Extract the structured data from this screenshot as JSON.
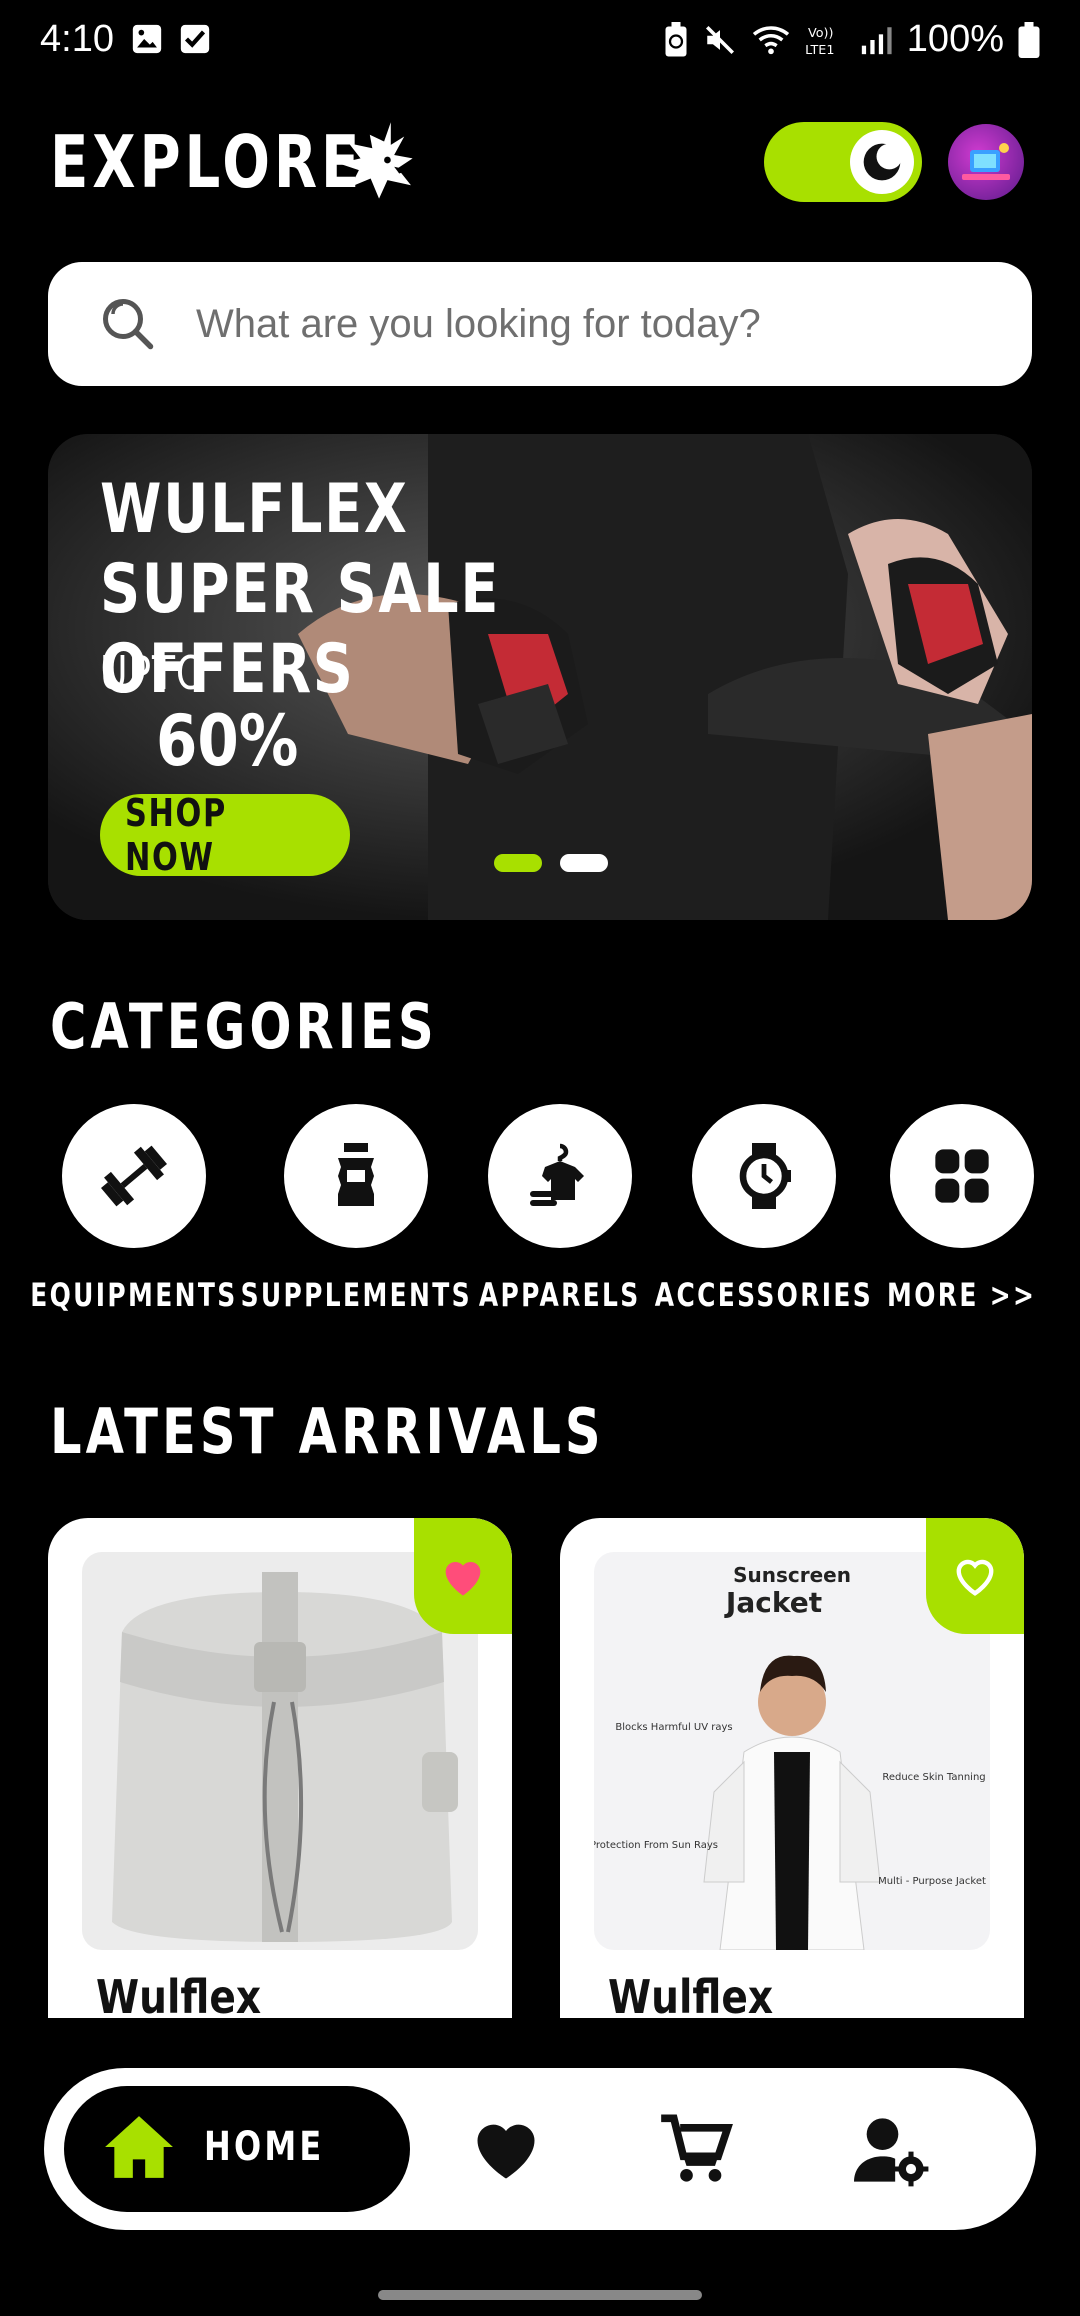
{
  "status_bar": {
    "time": "4:10",
    "battery": "100%"
  },
  "header": {
    "title": "EXPLORE"
  },
  "search": {
    "placeholder": "What are you looking for today?"
  },
  "banner": {
    "title": "WULFLEX SUPER SALE OFFERS",
    "upto": "UPTO",
    "discount": "60%",
    "cta": "SHOP NOW",
    "slides_total": 2,
    "active_slide": 1
  },
  "categories": {
    "title": "CATEGORIES",
    "items": [
      {
        "label": "EQUIPMENTS",
        "icon": "dumbbell-icon"
      },
      {
        "label": "SUPPLEMENTS",
        "icon": "supplement-bottle-icon"
      },
      {
        "label": "APPARELS",
        "icon": "apparel-hanger-icon"
      },
      {
        "label": "ACCESSORIES",
        "icon": "watch-icon"
      },
      {
        "label": "MORE >>",
        "icon": "grid-icon"
      }
    ]
  },
  "latest": {
    "title": "LATEST ARRIVALS",
    "products": [
      {
        "brand": "Wulflex",
        "favorited": true
      },
      {
        "brand": "Wulflex",
        "favorited": false,
        "image_text": {
          "line1": "Sunscreen",
          "line2": "Jacket",
          "callouts": [
            "Blocks Harmful UV rays",
            "Reduce Skin Tanning",
            "Protection From Sun Rays",
            "Multi - Purpose Jacket"
          ]
        }
      }
    ]
  },
  "bottom_nav": {
    "home_label": "HOME"
  },
  "colors": {
    "accent": "#a8e000",
    "background": "#000000",
    "favorite": "#ff4d7a"
  }
}
